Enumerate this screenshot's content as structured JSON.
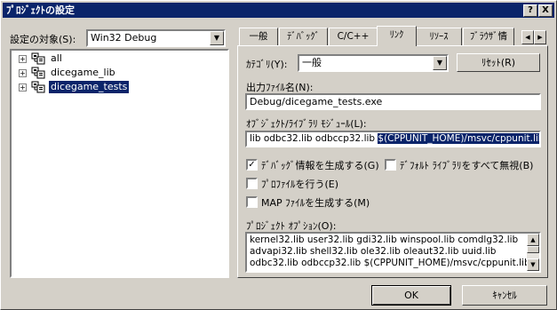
{
  "window": {
    "title": "ﾌﾟﾛｼﾞｪｸﾄの設定",
    "help_btn": "?",
    "close_btn": "X"
  },
  "left": {
    "settings_label": "設定の対象(S):",
    "config_value": "Win32 Debug",
    "tree": [
      {
        "label": "all",
        "selected": false
      },
      {
        "label": "dicegame_lib",
        "selected": false
      },
      {
        "label": "dicegame_tests",
        "selected": true
      }
    ]
  },
  "tabs": [
    {
      "label": "一般",
      "active": false
    },
    {
      "label": "ﾃﾞﾊﾞｯｸﾞ",
      "active": false
    },
    {
      "label": "C/C++",
      "active": false
    },
    {
      "label": "ﾘﾝｸ",
      "active": true
    },
    {
      "label": "ﾘｿｰｽ",
      "active": false
    },
    {
      "label": "ﾌﾞﾗｳｻﾞ情",
      "active": false
    }
  ],
  "link": {
    "category_label": "ｶﾃｺﾞﾘ(Y):",
    "category_value": "一般",
    "reset_label": "ﾘｾｯﾄ(R)",
    "output_label": "出力ﾌｧｲﾙ名(N):",
    "output_value": "Debug/dicegame_tests.exe",
    "modules_label": "ｵﾌﾞｼﾞｪｸﾄ/ﾗｲﾌﾞﾗﾘ ﾓｼﾞｭｰﾙ(L):",
    "modules_plain": "lib odbc32.lib odbccp32.lib ",
    "modules_selected": "$(CPPUNIT_HOME)/msvc/cppunit.lib",
    "cb_debug_label": "ﾃﾞﾊﾞｯｸﾞ情報を生成する(G)",
    "cb_default_libs_label": "ﾃﾞﾌｫﾙﾄ ﾗｲﾌﾞﾗﾘをすべて無視(B)",
    "cb_profile_label": "ﾌﾟﾛﾌｧｲﾙを行う(E)",
    "cb_map_label": "MAP ﾌｧｲﾙを生成する(M)",
    "cb_debug_checked": true,
    "cb_default_libs_checked": false,
    "cb_profile_checked": false,
    "cb_map_checked": false,
    "project_options_label": "ﾌﾟﾛｼﾞｪｸﾄ ｵﾌﾟｼｮﾝ(O):",
    "project_options_lines": [
      "kernel32.lib user32.lib gdi32.lib winspool.lib comdlg32.lib",
      "advapi32.lib shell32.lib ole32.lib oleaut32.lib uuid.lib",
      "odbc32.lib odbccp32.lib $(CPPUNIT_HOME)/msvc/cppunit.lib"
    ]
  },
  "buttons": {
    "ok": "OK",
    "cancel": "ｷｬﾝｾﾙ"
  },
  "icons": {
    "tree_expand": "plus-box-icon",
    "tree_project": "project-icon",
    "tab_scroll_left": "arrow-left-icon",
    "tab_scroll_right": "arrow-right-icon",
    "dropdown": "chevron-down-icon"
  }
}
